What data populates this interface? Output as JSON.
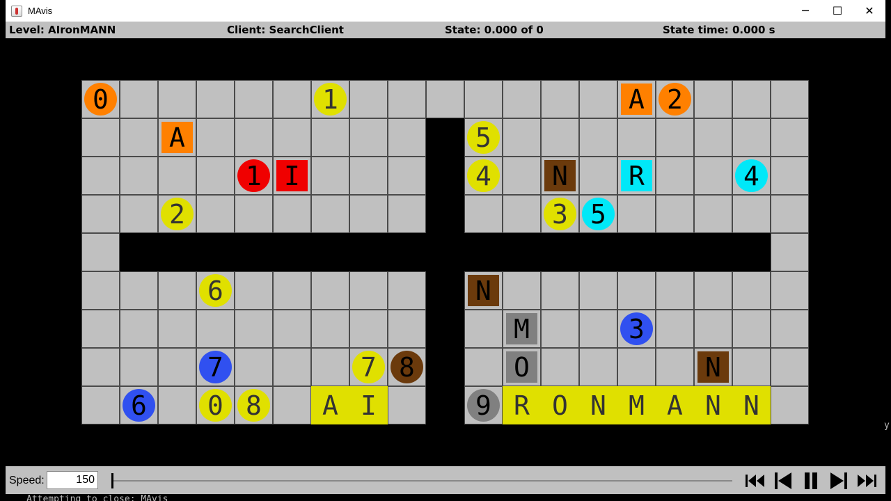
{
  "window": {
    "title": "MAvis",
    "minimize_glyph": "─",
    "maximize_glyph": "☐",
    "close_glyph": "✕"
  },
  "status": {
    "level": "Level: AIronMANN",
    "client": "Client: SearchClient",
    "state": "State: 0.000 of 0",
    "state_time": "State time: 0.000 s"
  },
  "controls": {
    "speed_label": "Speed:",
    "speed_value": "150",
    "playback_position": 0,
    "buttons": [
      "skip-to-start",
      "step-back",
      "pause",
      "step-forward",
      "skip-to-end"
    ]
  },
  "console": {
    "line": "Attempting to close: MAvis",
    "side_char": "y"
  },
  "colors": {
    "floor": "#c0c0c0",
    "wall": "#000000",
    "orange": "#ff8000",
    "yellow": "#e0e000",
    "red": "#f00000",
    "cyan": "#00e8f8",
    "blue": "#3050f0",
    "brown": "#6b3a0c",
    "gray": "#808080"
  },
  "board": {
    "cols": 19,
    "rows": 9,
    "floor_rows": [
      "xxxxxxxxxxxxxxxxxxx",
      "xxxxxxxxx.xxxxxxxxx",
      "xxxxxxxxx.xxxxxxxxx",
      "xxxxxxxxx.xxxxxxxxx",
      "x.................x",
      "xxxxxxxxx.xxxxxxxxx",
      "xxxxxxxxx.xxxxxxxxx",
      "xxxxxxxxx.xxxxxxxxx",
      "xxxxxxxxx.xxxxxxxxx"
    ],
    "agents": [
      {
        "label": "0",
        "row": 0,
        "col": 0,
        "color": "orange",
        "text": "#000"
      },
      {
        "label": "1",
        "row": 0,
        "col": 6,
        "color": "yellow",
        "text": "#333"
      },
      {
        "label": "2",
        "row": 0,
        "col": 15,
        "color": "orange",
        "text": "#000"
      },
      {
        "label": "5",
        "row": 1,
        "col": 10,
        "color": "yellow",
        "text": "#333"
      },
      {
        "label": "1",
        "row": 2,
        "col": 4,
        "color": "red",
        "text": "#000"
      },
      {
        "label": "4",
        "row": 2,
        "col": 10,
        "color": "yellow",
        "text": "#333"
      },
      {
        "label": "4",
        "row": 2,
        "col": 17,
        "color": "cyan",
        "text": "#000"
      },
      {
        "label": "2",
        "row": 3,
        "col": 2,
        "color": "yellow",
        "text": "#333"
      },
      {
        "label": "3",
        "row": 3,
        "col": 12,
        "color": "yellow",
        "text": "#333"
      },
      {
        "label": "5",
        "row": 3,
        "col": 13,
        "color": "cyan",
        "text": "#000"
      },
      {
        "label": "6",
        "row": 5,
        "col": 3,
        "color": "yellow",
        "text": "#333"
      },
      {
        "label": "3",
        "row": 6,
        "col": 14,
        "color": "blue",
        "text": "#000"
      },
      {
        "label": "7",
        "row": 7,
        "col": 3,
        "color": "blue",
        "text": "#000"
      },
      {
        "label": "7",
        "row": 7,
        "col": 7,
        "color": "yellow",
        "text": "#333"
      },
      {
        "label": "8",
        "row": 7,
        "col": 8,
        "color": "brown",
        "text": "#000"
      },
      {
        "label": "6",
        "row": 8,
        "col": 1,
        "color": "blue",
        "text": "#000"
      },
      {
        "label": "0",
        "row": 8,
        "col": 3,
        "color": "yellow",
        "text": "#333"
      },
      {
        "label": "8",
        "row": 8,
        "col": 4,
        "color": "yellow",
        "text": "#333"
      },
      {
        "label": "9",
        "row": 8,
        "col": 10,
        "color": "gray",
        "text": "#000"
      }
    ],
    "boxes": [
      {
        "label": "A",
        "row": 0,
        "col": 14,
        "color": "orange",
        "text": "#000"
      },
      {
        "label": "A",
        "row": 1,
        "col": 2,
        "color": "orange",
        "text": "#000"
      },
      {
        "label": "I",
        "row": 2,
        "col": 5,
        "color": "red",
        "text": "#000"
      },
      {
        "label": "N",
        "row": 2,
        "col": 12,
        "color": "brown",
        "text": "#000"
      },
      {
        "label": "R",
        "row": 2,
        "col": 14,
        "color": "cyan",
        "text": "#000"
      },
      {
        "label": "N",
        "row": 5,
        "col": 10,
        "color": "brown",
        "text": "#000"
      },
      {
        "label": "M",
        "row": 6,
        "col": 11,
        "color": "gray",
        "text": "#000"
      },
      {
        "label": "O",
        "row": 7,
        "col": 11,
        "color": "gray",
        "text": "#000"
      },
      {
        "label": "N",
        "row": 7,
        "col": 16,
        "color": "brown",
        "text": "#000"
      }
    ],
    "goals": [
      {
        "label": "A",
        "row": 8,
        "col": 6,
        "color": "yellow",
        "text": "#333"
      },
      {
        "label": "I",
        "row": 8,
        "col": 7,
        "color": "yellow",
        "text": "#333"
      },
      {
        "label": "R",
        "row": 8,
        "col": 11,
        "color": "yellow",
        "text": "#333"
      },
      {
        "label": "O",
        "row": 8,
        "col": 12,
        "color": "yellow",
        "text": "#333"
      },
      {
        "label": "N",
        "row": 8,
        "col": 13,
        "color": "yellow",
        "text": "#333"
      },
      {
        "label": "M",
        "row": 8,
        "col": 14,
        "color": "yellow",
        "text": "#333"
      },
      {
        "label": "A",
        "row": 8,
        "col": 15,
        "color": "yellow",
        "text": "#333"
      },
      {
        "label": "N",
        "row": 8,
        "col": 16,
        "color": "yellow",
        "text": "#333"
      },
      {
        "label": "N",
        "row": 8,
        "col": 17,
        "color": "yellow",
        "text": "#333"
      }
    ]
  }
}
